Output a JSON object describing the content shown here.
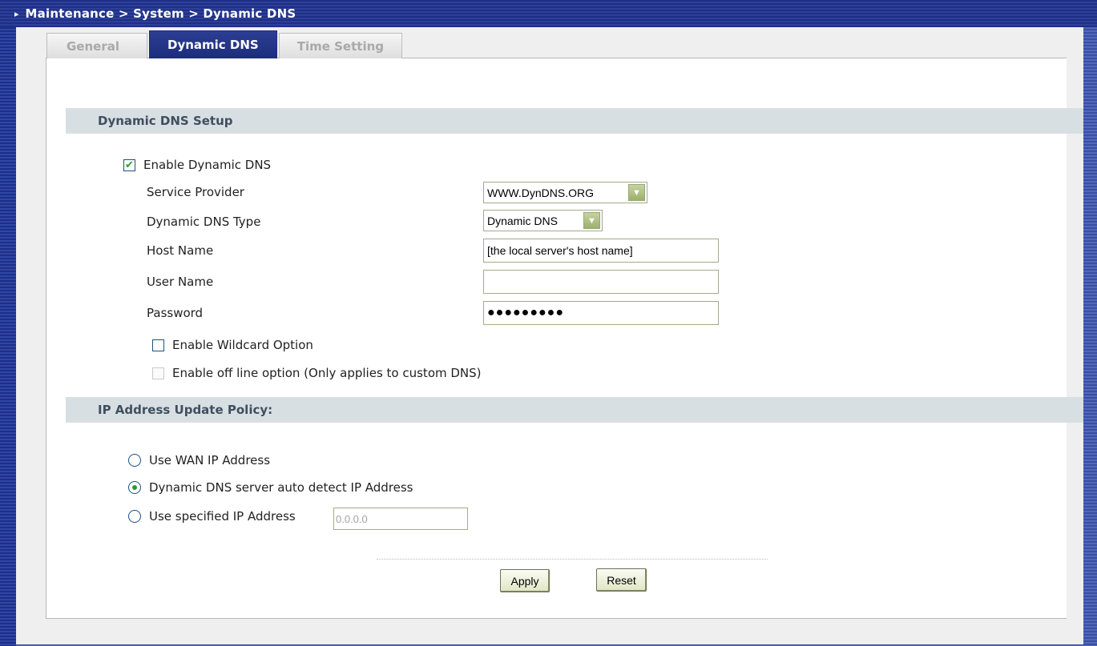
{
  "breadcrumb": "Maintenance > System > Dynamic DNS",
  "tabs": [
    {
      "label": "General",
      "active": false
    },
    {
      "label": "Dynamic DNS",
      "active": true
    },
    {
      "label": "Time Setting",
      "active": false
    }
  ],
  "setup": {
    "heading": "Dynamic DNS Setup",
    "enable_ddns": {
      "label": "Enable Dynamic DNS",
      "checked": true
    },
    "service_provider": {
      "label": "Service Provider",
      "value": "WWW.DynDNS.ORG"
    },
    "ddns_type": {
      "label": "Dynamic DNS Type",
      "value": "Dynamic DNS"
    },
    "host_name": {
      "label": "Host Name",
      "value": "[the local server's host name]"
    },
    "user_name": {
      "label": "User Name",
      "value": ""
    },
    "password": {
      "label": "Password",
      "value": "●●●●●●●●●"
    },
    "wildcard": {
      "label": "Enable Wildcard Option",
      "checked": false
    },
    "offline": {
      "label": "Enable off line option (Only applies to custom DNS)",
      "checked": false,
      "disabled": true
    }
  },
  "policy": {
    "heading": "IP Address Update Policy:",
    "options": [
      {
        "label": "Use WAN IP Address",
        "selected": false
      },
      {
        "label": "Dynamic DNS server auto detect IP Address",
        "selected": true
      },
      {
        "label": "Use specified IP Address",
        "selected": false
      }
    ],
    "specified_ip": "0.0.0.0"
  },
  "buttons": {
    "apply": "Apply",
    "reset": "Reset"
  },
  "colors": {
    "title_bar": "#1d2f86",
    "tab_active": "#2c3e93",
    "section_bg": "#d8dfe3",
    "check_green": "#22a22a"
  }
}
